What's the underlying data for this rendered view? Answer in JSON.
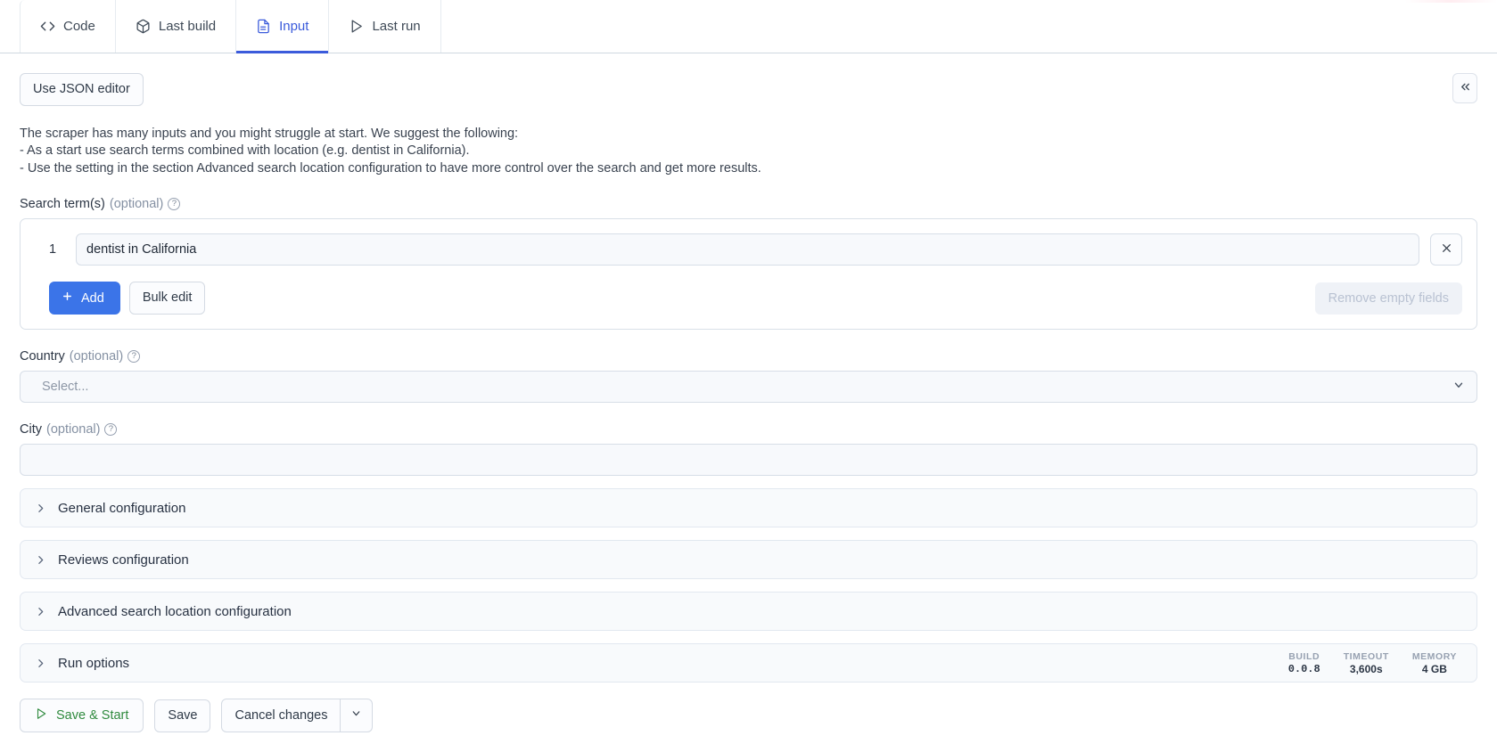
{
  "tabs": [
    {
      "id": "code",
      "label": "Code",
      "icon": "code-icon",
      "active": false
    },
    {
      "id": "last-build",
      "label": "Last build",
      "icon": "package-icon",
      "active": false
    },
    {
      "id": "input",
      "label": "Input",
      "icon": "document-icon",
      "active": true
    },
    {
      "id": "last-run",
      "label": "Last run",
      "icon": "play-icon",
      "active": false
    }
  ],
  "toolbar": {
    "json_editor_label": "Use JSON editor",
    "collapse_icon": "double-chevron-left-icon"
  },
  "description": [
    "The scraper has many inputs and you might struggle at start. We suggest the following:",
    "- As a start use search terms combined with location (e.g. dentist in California).",
    "- Use the setting in the section Advanced search location configuration to have more control over the search and get more results."
  ],
  "search_terms": {
    "label": "Search term(s)",
    "optional": "(optional)",
    "help_icon": "question-circle-icon",
    "rows": [
      {
        "index": "1",
        "value": "dentist in California",
        "placeholder": "",
        "remove_icon": "close-icon"
      }
    ],
    "add_label": "Add",
    "add_icon": "plus-icon",
    "bulk_edit_label": "Bulk edit",
    "remove_empty_label": "Remove empty fields",
    "remove_empty_disabled": true
  },
  "country": {
    "label": "Country",
    "optional": "(optional)",
    "help_icon": "question-circle-icon",
    "placeholder": "Select...",
    "value": "",
    "caret_icon": "chevron-down-icon"
  },
  "city": {
    "label": "City",
    "optional": "(optional)",
    "help_icon": "question-circle-icon",
    "placeholder": "",
    "value": ""
  },
  "sections": [
    {
      "id": "general",
      "title": "General configuration",
      "chevron": "chevron-right-icon"
    },
    {
      "id": "reviews",
      "title": "Reviews configuration",
      "chevron": "chevron-right-icon"
    },
    {
      "id": "advanced",
      "title": "Advanced search location configuration",
      "chevron": "chevron-right-icon"
    }
  ],
  "run_options": {
    "title": "Run options",
    "chevron": "chevron-right-icon",
    "meta": [
      {
        "key": "BUILD",
        "value": "0.0.8",
        "mono": true
      },
      {
        "key": "TIMEOUT",
        "value": "3,600s",
        "mono": false
      },
      {
        "key": "MEMORY",
        "value": "4 GB",
        "mono": false
      }
    ]
  },
  "footer": {
    "save_start_label": "Save & Start",
    "save_start_icon": "play-icon",
    "save_label": "Save",
    "cancel_label": "Cancel changes",
    "cancel_caret_icon": "chevron-down-icon"
  },
  "colors": {
    "accent": "#3b5bdb",
    "primary_button": "#3b74e8",
    "save_start_text": "#2f8a3e",
    "border": "#d7dee7",
    "input_bg": "#f7f9fc",
    "accordion_bg": "#f8fafc"
  }
}
